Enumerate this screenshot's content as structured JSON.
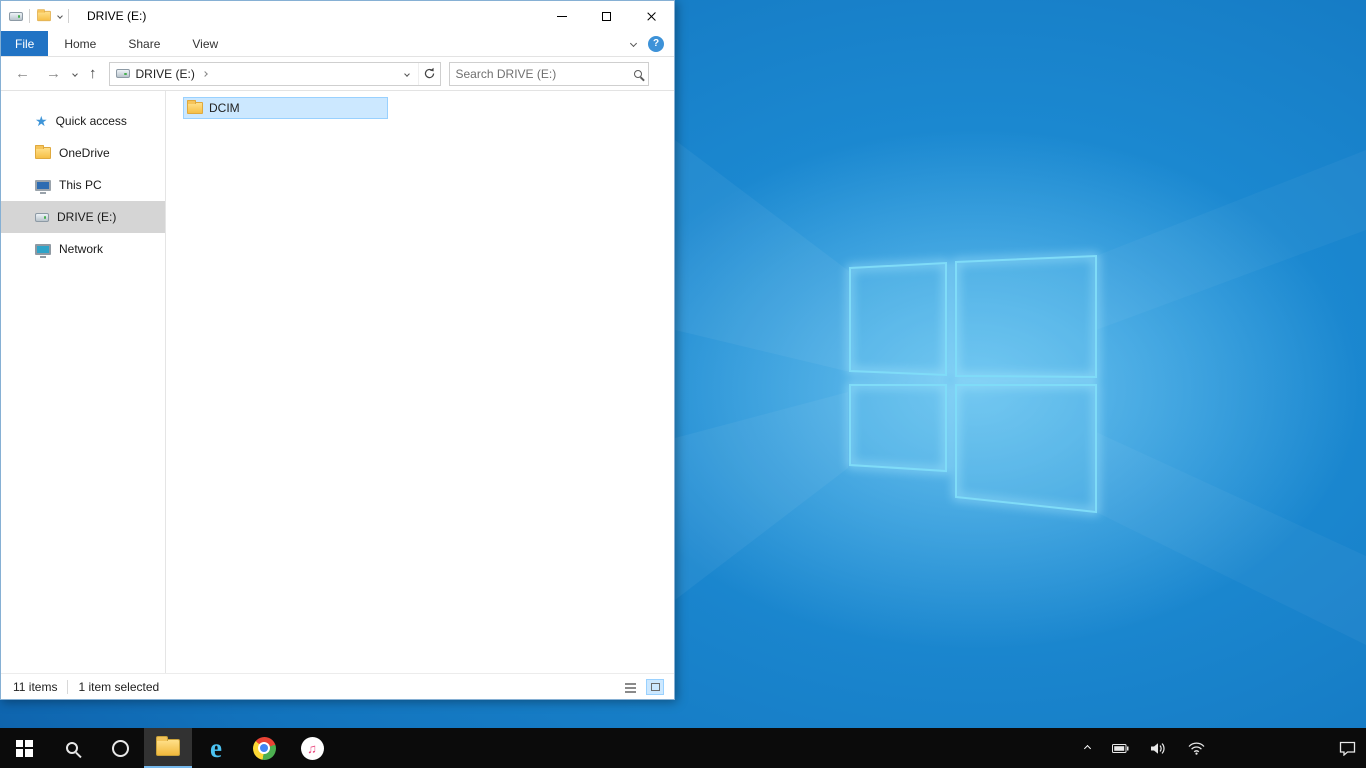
{
  "colors": {
    "accent": "#2173c4",
    "selection_bg": "#cce8ff",
    "selection_border": "#99d1ff",
    "sidebar_selected_bg": "#d5d5d5",
    "taskbar_bg": "#0b0b0b",
    "wallpaper_base": "#0b559e",
    "wallpaper_glow": "#7fdcf8"
  },
  "icons": {
    "ie_glyph": "e",
    "itunes_glyph": "♫",
    "star_glyph": "★",
    "back_glyph": "←",
    "forward_glyph": "→",
    "up_glyph": "↑"
  },
  "window": {
    "title": "DRIVE (E:)",
    "ribbon": {
      "tabs": [
        {
          "label": "File",
          "active": true
        },
        {
          "label": "Home",
          "active": false
        },
        {
          "label": "Share",
          "active": false
        },
        {
          "label": "View",
          "active": false
        }
      ],
      "help_glyph": "?"
    },
    "navigation": {
      "breadcrumb_root": "DRIVE (E:)",
      "search_placeholder": "Search DRIVE (E:)"
    },
    "sidebar": {
      "items": [
        {
          "label": "Quick access",
          "icon": "star-icon",
          "selected": false
        },
        {
          "label": "OneDrive",
          "icon": "onedrive-folder-icon",
          "selected": false
        },
        {
          "label": "This PC",
          "icon": "pc-icon",
          "selected": false
        },
        {
          "label": "DRIVE (E:)",
          "icon": "drive-icon",
          "selected": true
        },
        {
          "label": "Network",
          "icon": "network-icon",
          "selected": false
        }
      ]
    },
    "files": [
      {
        "name": "DCIM",
        "icon": "folder-icon",
        "selected": true
      }
    ],
    "statusbar": {
      "item_count": "11 items",
      "selection": "1 item selected"
    }
  },
  "taskbar": {
    "apps": [
      "start",
      "search",
      "cortana",
      "file-explorer",
      "internet-explorer",
      "chrome",
      "itunes"
    ],
    "active_app": "file-explorer",
    "tray": [
      "hidden-icons",
      "battery",
      "volume",
      "wifi",
      "action-center"
    ]
  }
}
